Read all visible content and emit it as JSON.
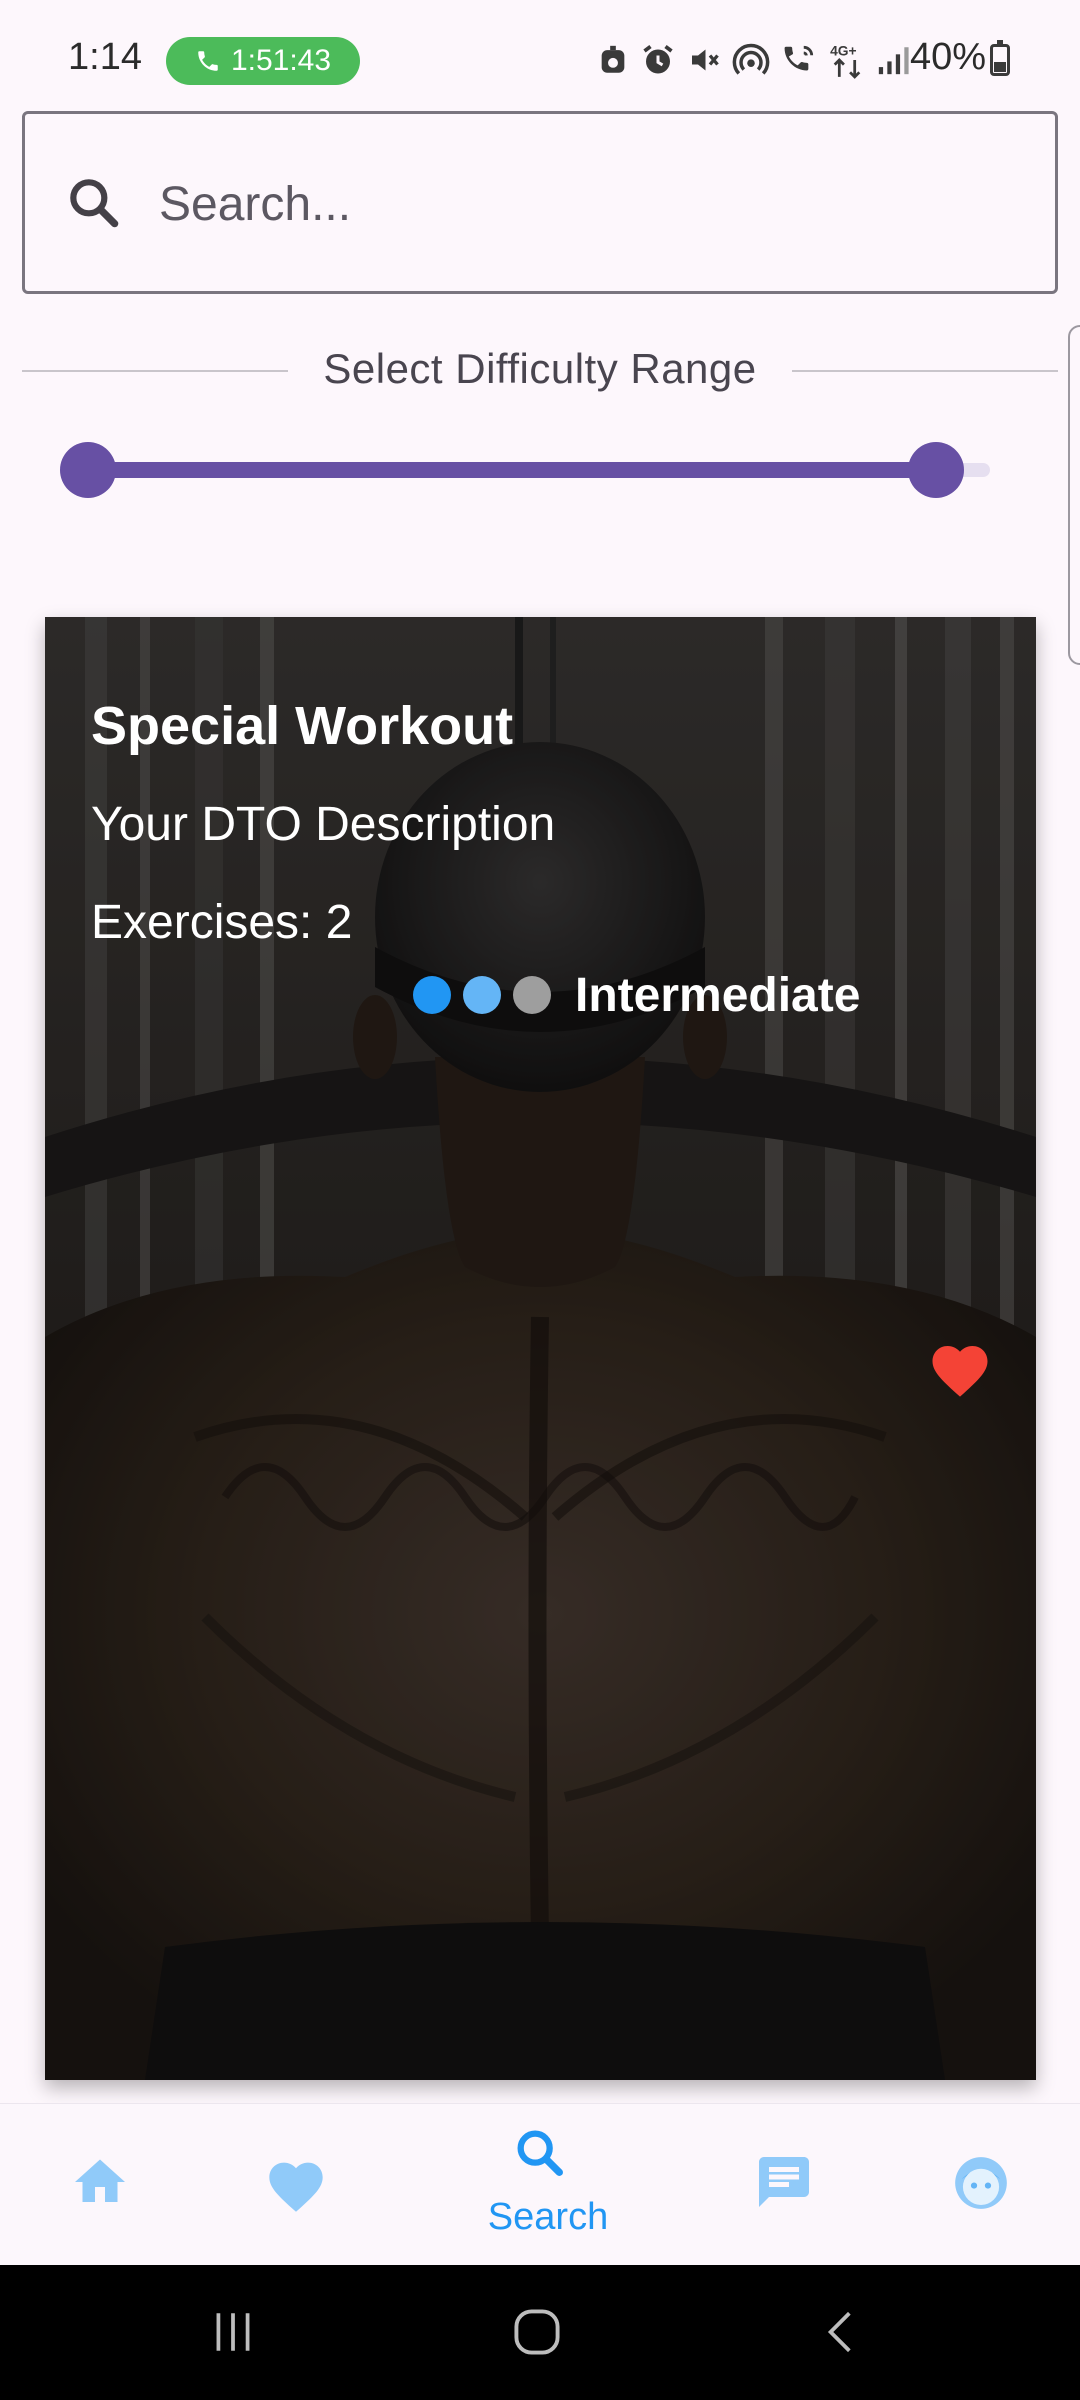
{
  "status_bar": {
    "time": "1:14",
    "call_duration": "1:51:43",
    "battery": "40%",
    "icons": [
      "android-head-icon",
      "alarm-icon",
      "mute-icon",
      "hotspot-icon",
      "wifi-call-icon",
      "4g-plus-icon",
      "signal-icon",
      "battery-icon"
    ],
    "network_label": "4G+"
  },
  "search": {
    "placeholder": "Search...",
    "value": "",
    "icon": "search-icon"
  },
  "difficulty_filter": {
    "label": "Select Difficulty Range",
    "range_start_fraction": 0.0,
    "range_end_fraction": 0.94,
    "accent_color": "#6750a4"
  },
  "workout_card": {
    "title": "Special Workout",
    "description": "Your DTO Description",
    "exercises_text": "Exercises: 2",
    "difficulty_label": "Intermediate",
    "difficulty_level": 2,
    "difficulty_max": 3,
    "dot_colors": [
      "#2196f3",
      "#64b5f6",
      "#9e9e9e"
    ],
    "favorite": true,
    "favorite_color": "#f44336",
    "image": "gym-back-photo"
  },
  "bottom_nav": {
    "accent_color": "#2196f3",
    "items": [
      {
        "icon": "home-icon",
        "label": ""
      },
      {
        "icon": "heart-icon",
        "label": ""
      },
      {
        "icon": "search-icon",
        "label": "Search",
        "active": true
      },
      {
        "icon": "chat-icon",
        "label": ""
      },
      {
        "icon": "face-icon",
        "label": ""
      }
    ]
  },
  "system_nav": {
    "buttons": [
      "recents-icon",
      "home-circle-icon",
      "back-icon"
    ]
  }
}
